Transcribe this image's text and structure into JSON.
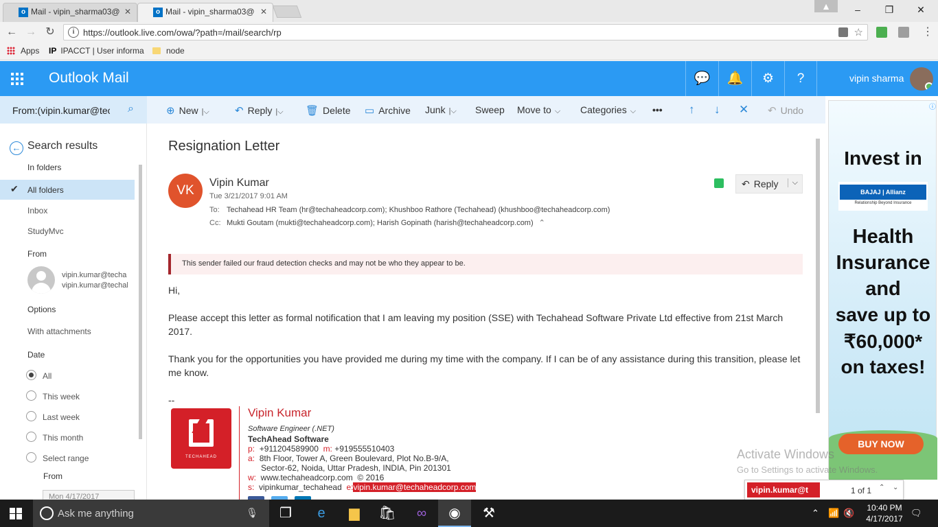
{
  "browser": {
    "tabs": [
      {
        "label": "Mail - vipin_sharma03@"
      },
      {
        "label": "Mail - vipin_sharma03@"
      }
    ],
    "url": "https://outlook.live.com/owa/?path=/mail/search/rp",
    "bookmarks": [
      {
        "label": "Apps"
      },
      {
        "label": "IPACCT | User informa"
      },
      {
        "label": "node"
      }
    ]
  },
  "header": {
    "app_title": "Outlook Mail",
    "user_name": "vipin sharma"
  },
  "search": {
    "query": "From:(vipin.kumar@tecl"
  },
  "leftpane": {
    "back_label": "Search results",
    "in_folders_heading": "In folders",
    "folders": [
      "All folders",
      "Inbox",
      "StudyMvc"
    ],
    "from_heading": "From",
    "from_line1": "vipin.kumar@techa",
    "from_line2": "vipin.kumar@techal",
    "options_heading": "Options",
    "with_attachments": "With attachments",
    "date_heading": "Date",
    "date_options": [
      "All",
      "This week",
      "Last week",
      "This month",
      "Select range"
    ],
    "range_from_label": "From",
    "range_from_value": "Mon 4/17/2017"
  },
  "commands": {
    "new": "New",
    "reply": "Reply",
    "delete": "Delete",
    "archive": "Archive",
    "junk": "Junk",
    "sweep": "Sweep",
    "move_to": "Move to",
    "categories": "Categories",
    "more": "•••",
    "undo": "Undo"
  },
  "message": {
    "subject": "Resignation Letter",
    "sender_initials": "VK",
    "sender_name": "Vipin Kumar",
    "date": "Tue 3/21/2017 9:01 AM",
    "to_label": "To:",
    "to": "Techahead HR Team (hr@techaheadcorp.com);  Khushboo Rathore (Techahead) (khushboo@techaheadcorp.com)",
    "cc_label": "Cc:",
    "cc": "Mukti Goutam (mukti@techaheadcorp.com);  Harish Gopinath (harish@techaheadcorp.com)",
    "reply_label": "Reply",
    "warning": "This sender failed our fraud detection checks and may not be who they appear to be.",
    "greeting": "Hi,",
    "para1": "Please accept this letter as formal notification that I am leaving my position (SSE) with Techahead Software Private Ltd effective from 21st March 2017.",
    "para2": "Thank you for the opportunities you have provided me during my time with the company. If I can be of any assistance during this transition, please let me know.",
    "dashes": "--"
  },
  "signature": {
    "logo_text": "TECHAHEAD",
    "name": "Vipin Kumar",
    "title": "Software Engineer (.NET)",
    "company": "TechAhead Software",
    "p_label": "p:",
    "phone": "+911204589900",
    "m_label": "m:",
    "mobile": "+919555510403",
    "a_label": "a:",
    "address1": "8th Floor, Tower A, Green Boulevard, Plot No.B-9/A,",
    "address2": "Sector-62, Noida, Uttar Pradesh, INDIA, Pin 201301",
    "w_label": "w:",
    "website": "www.techaheadcorp.com",
    "copyright": "© 2016",
    "s_label": "s:",
    "skype": "vipinkumar_techahead",
    "e_label": "e:",
    "email": "vipin.kumar@techaheadcorp.com"
  },
  "ad": {
    "line1": "Invest in",
    "brand": "BAJAJ | Allianz",
    "brand_tag": "Relationship Beyond Insurance",
    "lines": [
      "Health",
      "Insurance",
      "and",
      "save up to",
      "₹60,000*",
      "on taxes!"
    ],
    "cta": "BUY NOW"
  },
  "watermark": {
    "line1": "Activate Windows",
    "line2": "Go to Settings to activate Windows."
  },
  "findbar": {
    "query": "vipin.kumar@t",
    "count": "1 of 1"
  },
  "taskbar": {
    "search_placeholder": "Ask me anything",
    "time": "10:40 PM",
    "date": "4/17/2017"
  },
  "colors": {
    "outlook_blue": "#2b9af3",
    "selection": "#cce4f7",
    "warning_border": "#a4262c",
    "signature_red": "#d42028"
  }
}
